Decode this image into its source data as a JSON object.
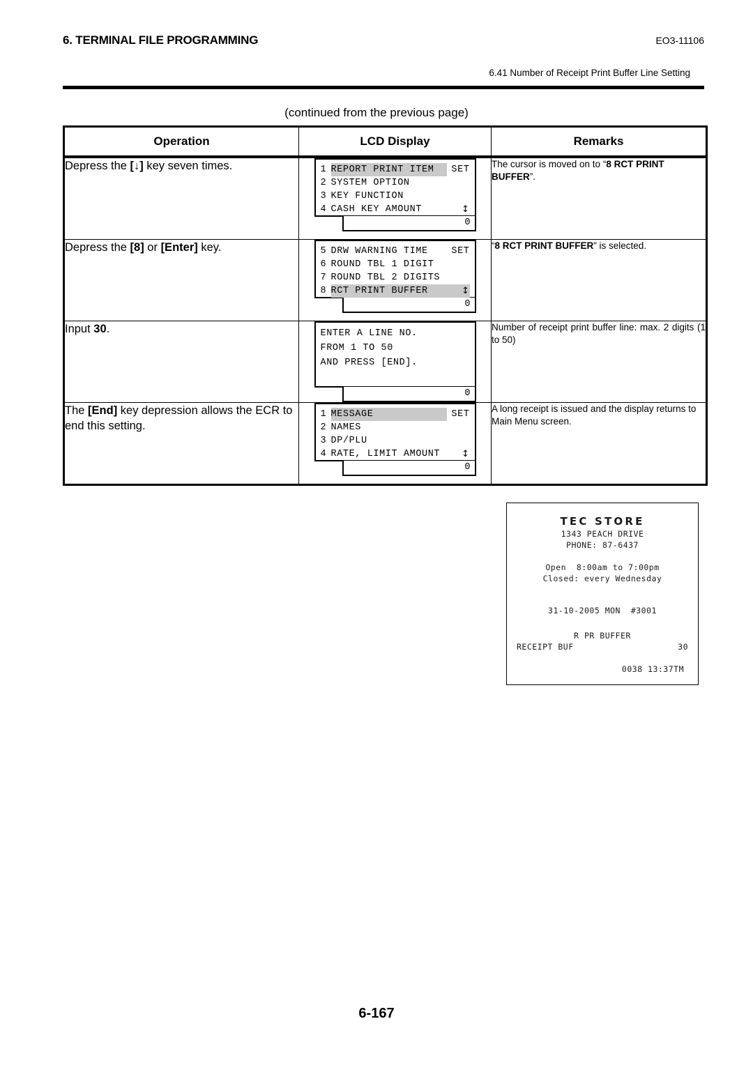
{
  "header": {
    "doc_title": "6. TERMINAL FILE PROGRAMMING",
    "doc_code": "EO3-11106",
    "section_subtitle": "6.41 Number of Receipt Print Buffer Line Setting"
  },
  "continued_note": "(continued from the previous page)",
  "table": {
    "columns": [
      "Operation",
      "LCD Display",
      "Remarks"
    ],
    "rows": [
      {
        "operation_pre": "Depress the ",
        "operation_key": "[↓]",
        "operation_post": " key seven times.",
        "operation_pre2": "",
        "operation_key2": "",
        "operation_post2": "",
        "lcd": {
          "lines": [
            {
              "num": "1",
              "text": "REPORT PRINT ITEM",
              "set": "SET",
              "highlight": true,
              "arrow": ""
            },
            {
              "num": "2",
              "text": "SYSTEM OPTION",
              "set": "",
              "highlight": false,
              "arrow": ""
            },
            {
              "num": "3",
              "text": "KEY FUNCTION",
              "set": "",
              "highlight": false,
              "arrow": ""
            },
            {
              "num": "4",
              "text": "CASH KEY AMOUNT",
              "set": "",
              "highlight": false,
              "arrow": "↕"
            }
          ],
          "value": "0"
        },
        "remarks_pre": "The cursor is moved on to “",
        "remarks_bold": "8 RCT PRINT BUFFER",
        "remarks_post": "”."
      },
      {
        "operation_pre": "Depress the ",
        "operation_key": "[8]",
        "operation_post": " or ",
        "operation_key2": "[Enter]",
        "operation_post2": " key.",
        "lcd": {
          "lines": [
            {
              "num": "5",
              "text": "DRW WARNING TIME",
              "set": "SET",
              "highlight": false,
              "arrow": ""
            },
            {
              "num": "6",
              "text": "ROUND TBL 1 DIGIT",
              "set": "",
              "highlight": false,
              "arrow": ""
            },
            {
              "num": "7",
              "text": "ROUND TBL 2 DIGITS",
              "set": "",
              "highlight": false,
              "arrow": ""
            },
            {
              "num": "8",
              "text": "RCT PRINT BUFFER",
              "set": "",
              "highlight": true,
              "arrow": "↕"
            }
          ],
          "value": "0"
        },
        "remarks_pre": "“",
        "remarks_bold": "8 RCT PRINT BUFFER",
        "remarks_post": "” is selected."
      },
      {
        "operation_pre": "Input ",
        "operation_key": "30",
        "operation_post": ".",
        "operation_key2": "",
        "operation_post2": "",
        "lcd": {
          "plain_lines": [
            "ENTER A LINE NO.",
            "FROM 1 TO 50",
            "AND PRESS [END]."
          ],
          "value": "0"
        },
        "remarks_plain": "Number of receipt print buffer line: max. 2 digits (1 to 50)"
      },
      {
        "operation_pre": "The ",
        "operation_key": "[End]",
        "operation_post": " key depression allows the ECR to end this setting.",
        "operation_key2": "",
        "operation_post2": "",
        "lcd": {
          "lines": [
            {
              "num": "1",
              "text": "MESSAGE",
              "set": "SET",
              "highlight": true,
              "arrow": ""
            },
            {
              "num": "2",
              "text": "NAMES",
              "set": "",
              "highlight": false,
              "arrow": ""
            },
            {
              "num": "3",
              "text": "DP/PLU",
              "set": "",
              "highlight": false,
              "arrow": ""
            },
            {
              "num": "4",
              "text": "RATE, LIMIT AMOUNT",
              "set": "",
              "highlight": false,
              "arrow": "↕"
            }
          ],
          "value": "0"
        },
        "remarks_plain": "A long receipt is issued and the display returns to Main Menu screen."
      }
    ]
  },
  "receipt": {
    "store_name": "TEC STORE",
    "address": "1343 PEACH DRIVE",
    "phone": "PHONE: 87-6437",
    "open_hours": "Open  8:00am to 7:00pm",
    "closed": "Closed: every Wednesday",
    "date_line": "31-10-2005 MON  #3001",
    "mode_title": "R PR BUFFER",
    "item_label": "RECEIPT BUF",
    "item_value": "30",
    "footer": "0038 13:37TM"
  },
  "page_number": "6-167",
  "colors": {
    "highlight": "#c9c9c9",
    "rule": "#000000"
  }
}
